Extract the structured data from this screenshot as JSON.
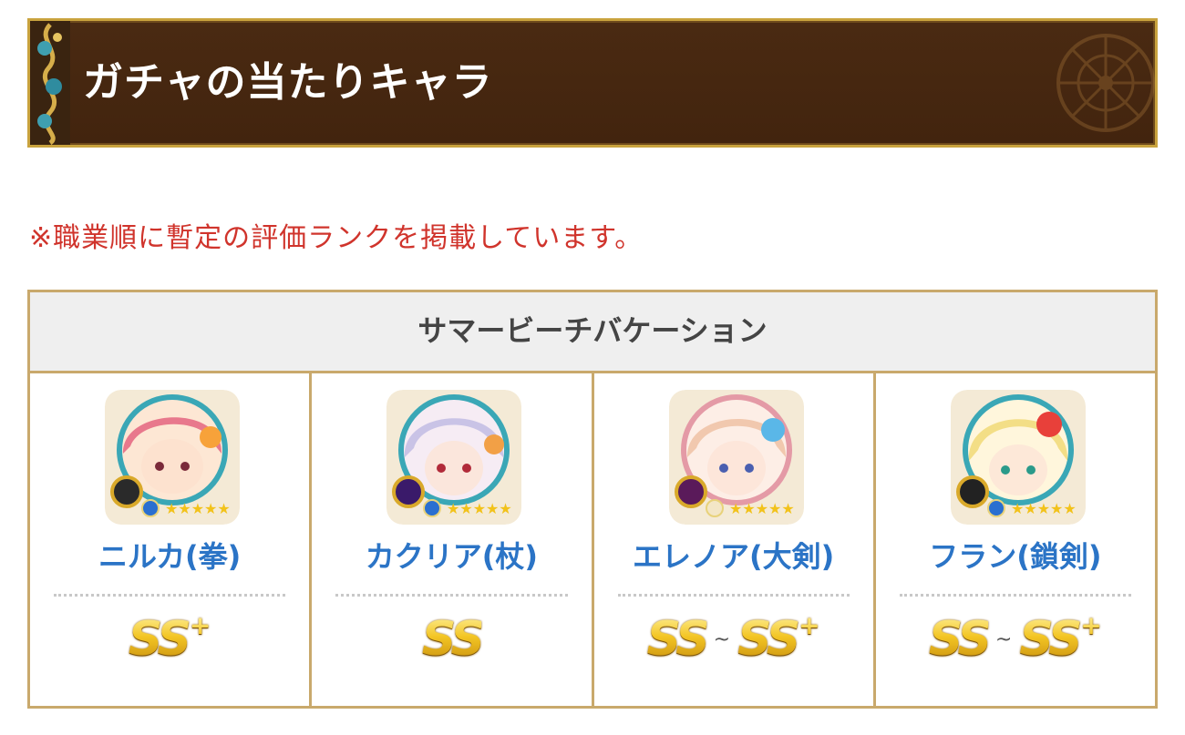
{
  "header": {
    "title": "ガチャの当たりキャラ"
  },
  "note": "※職業順に暫定の評価ランクを掲載しています。",
  "table": {
    "heading": "サマービーチバケーション",
    "characters": [
      {
        "name": "ニルカ(拳)",
        "rank_low": "",
        "rank_high": "SS",
        "rank_high_plus": "+",
        "tilde": "",
        "hair": "#e8788c",
        "accent": "#f7a23a"
      },
      {
        "name": "カクリア(杖)",
        "rank_low": "",
        "rank_high": "SS",
        "rank_high_plus": "",
        "tilde": "",
        "hair": "#c9c3e6",
        "accent": "#f2a046"
      },
      {
        "name": "エレノア(大剣)",
        "rank_low": "SS",
        "rank_high": "SS",
        "rank_high_plus": "+",
        "tilde": "~",
        "hair": "#f1c8ae",
        "accent": "#5ab7e8"
      },
      {
        "name": "フラン(鎖剣)",
        "rank_low": "SS",
        "rank_high": "SS",
        "rank_high_plus": "+",
        "tilde": "~",
        "hair": "#f3de86",
        "accent": "#e8403a"
      }
    ]
  },
  "icons": {
    "header_ornament": "ornament-frame-icon",
    "header_wheel": "compass-wheel-icon",
    "rarity": "star-icon"
  },
  "colors": {
    "banner": "#4a2a12",
    "gold_border": "#c9a33e",
    "note": "#d0342c",
    "name": "#2b74c6",
    "table_border": "#c9a96c"
  }
}
